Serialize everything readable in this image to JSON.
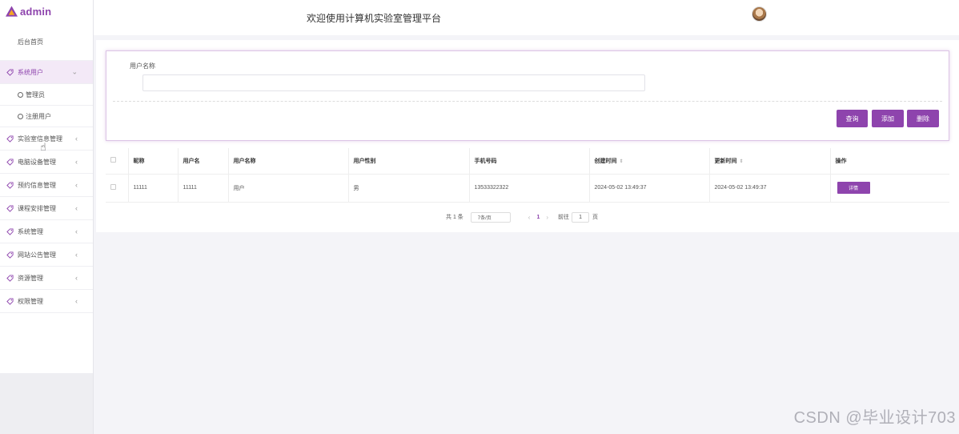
{
  "app": {
    "logo_text": "admin",
    "header_title": "欢迎使用计算机实验室管理平台",
    "accent_color": "#8e44ad"
  },
  "sidebar": {
    "home": "后台首页",
    "active_group": "系统用户",
    "active_sub": [
      "管理员",
      "注册用户"
    ],
    "groups": [
      "实验室信息管理",
      "电脑设备管理",
      "预约信息管理",
      "课程安排管理",
      "系统管理",
      "网站公告管理",
      "资源管理",
      "权限管理"
    ],
    "expand_icon": "chevron-down-icon",
    "collapse_icon": "chevron-left-icon"
  },
  "search": {
    "label": "用户名称",
    "value": "",
    "placeholder": "",
    "buttons": {
      "query": "查询",
      "add": "添加",
      "delete": "删除"
    }
  },
  "table": {
    "headers": [
      "昵称",
      "用户名",
      "用户名称",
      "用户性别",
      "手机号码",
      "创建时间",
      "更新时间",
      "操作"
    ],
    "rows": [
      {
        "nickname": "11111",
        "username": "11111",
        "user_title": "用户",
        "gender": "男",
        "phone": "13533322322",
        "created": "2024-05-02 13:49:37",
        "updated": "2024-05-02 13:49:37",
        "action": "详情"
      }
    ]
  },
  "pagination": {
    "total": "共 1 条",
    "page_size": "7条/页",
    "current_page": "1",
    "goto_label": "前往",
    "goto_value": "1",
    "page_unit": "页"
  },
  "watermark": "CSDN @毕业设计703"
}
